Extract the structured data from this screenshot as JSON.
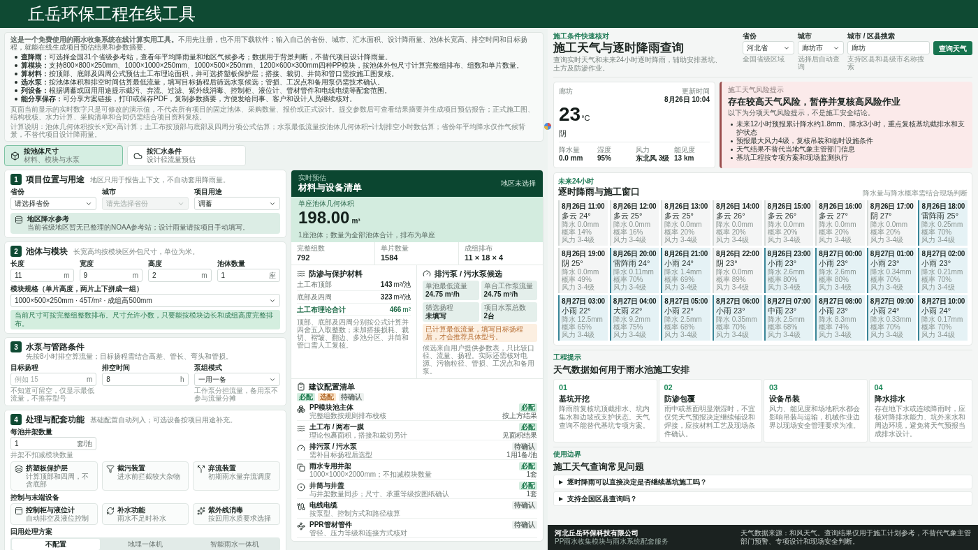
{
  "slide": {
    "title": "丘岳环保工程在线工具"
  },
  "calculator": {
    "intro": {
      "text": "**这是一个免费使用的雨水收集系统在线计算实用工具。**不用先注册，也不用下载软件；输入自己的省份、城市、汇水面积、设计降雨量、池体长宽高、排空时间和目标扬程，就能在线生成项目预估结果和参数摘要。",
      "bullets": [
        "**查降雨：**可选择全国31个省级参考站，查看年平均降雨量和地区气候参考；数据用于背景判断，不替代项目设计降雨量。",
        "**算模块：**支持800×800×250mm、1000×1000×250mm、1000×500×250mm、1200×600×300mm四种PP模块，按池体外包尺寸计算完整组排布、组数和单片数量。",
        "**算材料：**按顶部、底部及四周公式预估土工布理论面积，并可选挤塑板保护层；搭接、裁切、井筒和管口需按施工图复核。",
        "**选水泵：**按池体体积和排空时间估算最低流量，填写目标扬程后筛选水泵候选；管损、工况点和备用泵仍需技术确认。",
        "**列设备：**根据调蓄或回用用途提示截污、弃流、过滤、紫外线消毒、控制柜、液位计、管材管件和电线电缆等配套范围。",
        "**能分享保存：**可分享方案链接，打印或保存PDF，复制参数摘要，方便发给同事、客户和设计人员继续核对。"
      ],
      "notes": [
        "页面当前显示的实时数字只是可修改的演示值，不代表所有项目的固定池体、采购数量、报价或正式设计。提交参数后可查看结果摘要并生成项目预估报告；正式施工图、结构校核、水力计算、采购清单和合同仍需结合项目资料复核。",
        "计算说明：池体几何体积按长×宽×高计算；土工布按顶部与底部及四周分项公式估算；水泵最低流量按池体几何体积÷计划排空小时数估算；省份年平均降水仅作气候背景，不替代项目设计降雨量。"
      ]
    },
    "tabs": [
      {
        "title": "按池体尺寸",
        "subtitle": "材料、模块与水泵",
        "selected": true
      },
      {
        "title": "按汇水条件",
        "subtitle": "设计径流量预估",
        "selected": false
      }
    ],
    "location": {
      "number": "1",
      "title": "项目位置与用途",
      "subtitle": "地区只用于报告上下文，不自动套用降雨量。",
      "fields": [
        {
          "label": "省份",
          "kind": "select",
          "value": "请选择省份",
          "disabled": false
        },
        {
          "label": "城市",
          "kind": "select",
          "placeholder": "请先选择省份",
          "disabled": true
        },
        {
          "label": "项目用途",
          "kind": "select",
          "value": "调蓄",
          "disabled": false
        }
      ],
      "reference": {
        "title": "地区降水参考",
        "text": "当前省级地区暂无已整理的NOAA参考站；设计雨量请按项目手动填写。"
      }
    },
    "pool": {
      "number": "2",
      "title": "池体与模块",
      "subtitle": "长宽高均按模块区外包尺寸，单位为米。",
      "fields": [
        {
          "label": "长度",
          "kind": "input",
          "value": "11",
          "unit": "m"
        },
        {
          "label": "宽度",
          "kind": "input",
          "value": "9",
          "unit": "m"
        },
        {
          "label": "高度",
          "kind": "input",
          "value": "2",
          "unit": "m"
        },
        {
          "label": "池体数量",
          "kind": "input",
          "value": "1",
          "unit": "座"
        }
      ],
      "module": {
        "label": "模块规格（单片高度，两片上下拼成一组）",
        "kind": "select",
        "value": "1000×500×250mm · 45T/m² · 成组高500mm"
      },
      "note": "当前尺寸可按完整组整数排布。尺寸允许小数，只要能按模块边长和成组高度完整排布。"
    },
    "pump": {
      "number": "3",
      "title": "水泵与管路条件",
      "subtitle": "先按8小时排空算流量；目标扬程需结合高差、管长、弯头和管损。",
      "fields": [
        {
          "label": "目标扬程",
          "kind": "input",
          "placeholder": "例如 15",
          "unit": "m",
          "hint": "不知道可留空，仅显示最低流量，不推荐型号"
        },
        {
          "label": "排空时间",
          "kind": "input",
          "value": "8",
          "unit": "h"
        },
        {
          "label": "泵组模式",
          "kind": "select",
          "value": "一用一备",
          "hint": "工作泵分担流量，备用泵不参与流量分摊"
        }
      ]
    },
    "features": {
      "number": "4",
      "title": "处理与配套功能",
      "subtitle": "基础配置自动列入；可选设备按项目用途补充。",
      "field": {
        "label": "每池井架数量",
        "kind": "input",
        "value": "1",
        "unit": "套/池",
        "hint": "井架不扣减模块数量"
      },
      "groups": [
        {
          "options": [
            {
              "title": "挤塑板保护层",
              "text": "计算顶部和四周，不含底部"
            },
            {
              "title": "截污装置",
              "text": "进水前拦截较大杂物"
            },
            {
              "title": "弃流装置",
              "text": "初期雨水量弃流调度"
            }
          ]
        },
        {
          "label": "控制与末端设备",
          "options": [
            {
              "title": "控制柜与液位计",
              "text": "自动排空及液位控制"
            },
            {
              "title": "补水功能",
              "text": "雨水不足时补水"
            },
            {
              "title": "紫外线消毒",
              "text": "按回用水质要求选择"
            }
          ]
        }
      ],
      "reuse": {
        "label": "回用处理方案",
        "choices": [
          {
            "label": "不配置",
            "selected": true
          },
          {
            "label": "地埋一体机",
            "selected": false
          },
          {
            "label": "智能雨水一体机",
            "selected": false
          }
        ]
      }
    },
    "results": {
      "eyebrow": "实时预估",
      "title": "材料与设备清单",
      "region": "地区未选择",
      "volume": {
        "label": "单座池体几何体积",
        "value": "198.00",
        "unit": "m³",
        "note": "1座池体；数量为全部池体合计，排布为单座"
      },
      "stats": [
        {
          "label": "完整组数",
          "value": "792"
        },
        {
          "label": "单片数量",
          "value": "1584"
        },
        {
          "label": "成组排布",
          "value": "11 × 18 × 4"
        }
      ],
      "materials": {
        "title": "防渗与保护材料",
        "rows": [
          {
            "label": "土工布顶部",
            "value": "143",
            "unit": "m²/池",
            "total": false
          },
          {
            "label": "底部及四周",
            "value": "323",
            "unit": "m²/池",
            "total": false
          },
          {
            "label": "土工布理论合计",
            "value": "466",
            "unit": "m²",
            "total": true
          }
        ],
        "note": "顶部、底部及四周分别按公式计算并四舍五入取整数；未加搭接损耗、裁切、褶皱、翻边、多池分区、井筒和管口需人工复核。"
      },
      "pumps": {
        "title": "排污泵 / 污水泵候选",
        "metrics": [
          {
            "label": "单池最低流量",
            "value": "24.75 m³/h"
          },
          {
            "label": "单台工作泵流量",
            "value": "24.75 m³/h"
          },
          {
            "label": "筛选扬程",
            "value": "未填写"
          },
          {
            "label": "项目水泵总数",
            "value": "2台"
          }
        ],
        "warning": "已计算最低流量，填写目标扬程后，才会推荐具体型号。",
        "note": "候选来自用户提供参数表，只比较口径、流量、扬程。实际还需核对电源、污物粒径、管损、工况点和备用泵。"
      },
      "config": {
        "title": "建议配置清单",
        "legend": [
          {
            "label": "必配",
            "kind": "required"
          },
          {
            "label": "选配",
            "kind": "optional"
          },
          {
            "label": "待确认",
            "kind": "pending"
          }
        ],
        "items": [
          {
            "name": "PP模块池主体",
            "detail": "完整组数按规则排布校核",
            "tag": "必配",
            "kind": "required",
            "quantity": "按上方结果"
          },
          {
            "name": "土工布 / 两布一膜",
            "detail": "理论包裹面积，搭接和裁切另计",
            "tag": "必配",
            "kind": "required",
            "quantity": "见面积结果"
          },
          {
            "name": "排污泵 / 污水泵",
            "detail": "需补目标扬程后选型",
            "tag": "待确认",
            "kind": "pending",
            "quantity": "1用1备/池"
          },
          {
            "name": "雨水专用井架",
            "detail": "1000×1000×2000mm；不扣减模块数量",
            "tag": "必配",
            "kind": "required",
            "quantity": "1套"
          },
          {
            "name": "井筒与井盖",
            "detail": "与井架数量同步；尺寸、承重等级按图纸确认",
            "tag": "必配",
            "kind": "required",
            "quantity": "1套"
          },
          {
            "name": "电线电缆",
            "detail": "按泵型、控制方式和路径核算",
            "tag": "待确认",
            "kind": "pending"
          },
          {
            "name": "PPR管材管件",
            "detail": "管径、压力等级和连接方式核对",
            "tag": "待确认",
            "kind": "pending"
          }
        ]
      }
    }
  },
  "weather": {
    "eyebrow": "施工条件快速核对",
    "title": "施工天气与逐时降雨查询",
    "subtitle": "查询实时天气和未来24小时逐时降雨，辅助安排基坑、土方及防渗作业。",
    "query": {
      "fields": [
        {
          "label": "省份",
          "kind": "select",
          "value": "河北省",
          "hint": "全国省级区域"
        },
        {
          "label": "城市",
          "kind": "select",
          "value": "廊坊市",
          "hint": "选择后自动查询"
        },
        {
          "label": "城市 / 区县搜索",
          "kind": "input",
          "value": "廊坊",
          "hint": "支持区县和县级市名称搜索"
        }
      ],
      "button": "查询天气"
    },
    "current": {
      "place": "廊坊",
      "updated_label": "更新时间",
      "updated": "8月26日 10:04",
      "temperature": "23",
      "unit": "°C",
      "condition": "阴",
      "stats": [
        {
          "label": "降水量",
          "value": "0.0 mm"
        },
        {
          "label": "湿度",
          "value": "95%"
        },
        {
          "label": "风力",
          "value": "东北风 3级"
        },
        {
          "label": "能见度",
          "value": "13 km"
        }
      ]
    },
    "risk": {
      "eyebrow": "施工天气风险提示",
      "title": "存在较高天气风险，暂停并复核高风险作业",
      "subtitle": "以下为分项天气风险提示，不是施工安全结论。",
      "items": [
        "未来12小时预报累计降水约1.8mm、降水3小时，重点复核基坑截排水和支护状态",
        "预报最大风力4级，复核吊装和临时设施条件",
        "天气结果不替代当地气象主管部门信息",
        "基坑工程按专项方案和现场监测执行"
      ]
    },
    "hourly": {
      "eyebrow": "未来24小时",
      "title": "逐时降雨与施工窗口",
      "note": "降水量与降水概率需结合现场判断",
      "hours": [
        {
          "time": "8月26日 11:00",
          "condition": "多云 24°",
          "rain": "降水 0.0mm",
          "chance": "概率 14%",
          "wind": "风力 3-4级",
          "rainy": false
        },
        {
          "time": "8月26日 12:00",
          "condition": "多云 25°",
          "rain": "降水 0.0mm",
          "chance": "概率 16%",
          "wind": "风力 3-4级",
          "rainy": false
        },
        {
          "time": "8月26日 13:00",
          "condition": "多云 25°",
          "rain": "降水 0.0mm",
          "chance": "概率 20%",
          "wind": "风力 3-4级",
          "rainy": false
        },
        {
          "time": "8月26日 14:00",
          "condition": "多云 26°",
          "rain": "降水 0.0mm",
          "chance": "概率 20%",
          "wind": "风力 3-4级",
          "rainy": false
        },
        {
          "time": "8月26日 15:00",
          "condition": "多云 26°",
          "rain": "降水 0.0mm",
          "chance": "概率 20%",
          "wind": "风力 3-4级",
          "rainy": false
        },
        {
          "time": "8月26日 16:00",
          "condition": "多云 27°",
          "rain": "降水 0.0mm",
          "chance": "概率 20%",
          "wind": "风力 3-4级",
          "rainy": false
        },
        {
          "time": "8月26日 17:00",
          "condition": "阴 27°",
          "rain": "降水 0.0mm",
          "chance": "概率 20%",
          "wind": "风力 3-4级",
          "rainy": false
        },
        {
          "time": "8月26日 18:00",
          "condition": "雷阵雨 25°",
          "rain": "降水 0.25mm",
          "chance": "概率 70%",
          "wind": "风力 3-4级",
          "rainy": true
        },
        {
          "time": "8月26日 19:00",
          "condition": "阴 25°",
          "rain": "降水 0.0mm",
          "chance": "概率 49%",
          "wind": "风力 3-4级",
          "rainy": false
        },
        {
          "time": "8月26日 20:00",
          "condition": "雷阵雨 24°",
          "rain": "降水 0.11mm",
          "chance": "概率 70%",
          "wind": "风力 3-4级",
          "rainy": true
        },
        {
          "time": "8月26日 21:00",
          "condition": "小雨 24°",
          "rain": "降水 1.4mm",
          "chance": "概率 69%",
          "wind": "风力 3-4级",
          "rainy": true
        },
        {
          "time": "8月26日 22:00",
          "condition": "阴 23°",
          "rain": "降水 0.0mm",
          "chance": "概率 89%",
          "wind": "风力 3-4级",
          "rainy": false
        },
        {
          "time": "8月26日 23:00",
          "condition": "小雨 23°",
          "rain": "降水 2.6mm",
          "chance": "概率 80%",
          "wind": "风力 3-4级",
          "rainy": true
        },
        {
          "time": "8月27日 00:00",
          "condition": "小雨 23°",
          "rain": "降水 2.6mm",
          "chance": "概率 80%",
          "wind": "风力 3-4级",
          "rainy": true
        },
        {
          "time": "8月27日 01:00",
          "condition": "小雨 23°",
          "rain": "降水 0.34mm",
          "chance": "概率 70%",
          "wind": "风力 3-4级",
          "rainy": true
        },
        {
          "time": "8月27日 02:00",
          "condition": "小雨 23°",
          "rain": "降水 0.21mm",
          "chance": "概率 70%",
          "wind": "风力 3-4级",
          "rainy": true
        },
        {
          "time": "8月27日 03:00",
          "condition": "小雨 22°",
          "rain": "降水 12.5mm",
          "chance": "概率 65%",
          "wind": "风力 3-4级",
          "rainy": true
        },
        {
          "time": "8月27日 04:00",
          "condition": "大雨 22°",
          "rain": "降水 9.2mm",
          "chance": "概率 75%",
          "wind": "风力 3-4级",
          "rainy": true
        },
        {
          "time": "8月27日 05:00",
          "condition": "小雨 22°",
          "rain": "降水 2.5mm",
          "chance": "概率 68%",
          "wind": "风力 3-4级",
          "rainy": true
        },
        {
          "time": "8月27日 06:00",
          "condition": "小雨 23°",
          "rain": "降水 0.35mm",
          "chance": "概率 70%",
          "wind": "风力 3-4级",
          "rainy": true
        },
        {
          "time": "8月27日 07:00",
          "condition": "中雨 23°",
          "rain": "降水 2.5mm",
          "chance": "概率 68%",
          "wind": "风力 3-4级",
          "rainy": true
        },
        {
          "time": "8月27日 08:00",
          "condition": "小雨 23°",
          "rain": "降水 8.3mm",
          "chance": "概率 74%",
          "wind": "风力 3-4级",
          "rainy": true
        },
        {
          "time": "8月27日 09:00",
          "condition": "小雨 24°",
          "rain": "降水 0.33mm",
          "chance": "概率 70%",
          "wind": "风力 3-4级",
          "rainy": true
        },
        {
          "time": "8月27日 10:00",
          "condition": "小雨 24°",
          "rain": "降水 0.17mm",
          "chance": "概率 70%",
          "wind": "风力 3-4级",
          "rainy": true
        }
      ]
    },
    "guide": {
      "eyebrow": "工程提示",
      "title": "天气数据如何用于雨水池施工安排",
      "cards": [
        {
          "number": "01",
          "title": "基坑开挖",
          "text": "降雨前复核坑顶截排水、坑内集水和边坡或支护状态。天气查询不能替代基坑专项方案。"
        },
        {
          "number": "02",
          "title": "防渗包覆",
          "text": "雨中或基面明显潮湿时，不宜仅凭天气预报决定继续铺设和焊接，应按材料工艺及现场条件确认。"
        },
        {
          "number": "03",
          "title": "设备吊装",
          "text": "风力、能见度和场地积水都会影响吊装与运输，机械作业边界以现场安全管理要求为准。"
        },
        {
          "number": "04",
          "title": "降水排水",
          "text": "存在地下水或连续降雨时，应核对降排水能力、坑外来水和周边环境，避免将天气预报当成排水设计。"
        }
      ]
    },
    "faq": {
      "eyebrow": "使用边界",
      "title": "施工天气查询常见问题",
      "items": [
        {
          "question": "逐时降雨可以直接决定是否继续基坑施工吗？",
          "expanded": false
        },
        {
          "question": "支持全国区县查询吗？",
          "expanded": false
        }
      ]
    },
    "footer": {
      "company": "河北丘岳环保科技有限公司",
      "tagline": "PP雨水收集模块与雨水系统配套服务",
      "note": "天气数据来源：和风天气。查询结果仅用于施工计划参考，不替代气象主管部门预警、专项设计和现场安全判断。"
    }
  }
}
